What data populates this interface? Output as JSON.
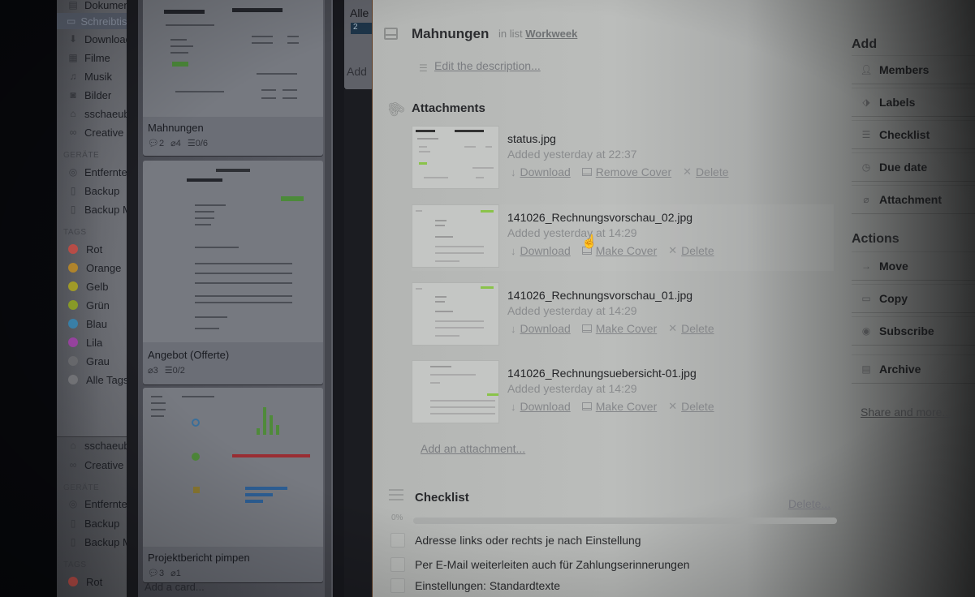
{
  "finder": {
    "favorites": [
      {
        "label": "Dokumente",
        "icon": "document-icon"
      },
      {
        "label": "Schreibtisch",
        "icon": "desktop-icon",
        "selected": true
      },
      {
        "label": "Downloads",
        "icon": "download-icon"
      },
      {
        "label": "Filme",
        "icon": "film-icon"
      },
      {
        "label": "Musik",
        "icon": "music-icon"
      },
      {
        "label": "Bilder",
        "icon": "camera-icon"
      },
      {
        "label": "sschaeub",
        "icon": "home-icon"
      },
      {
        "label": "Creative",
        "icon": "creative-cloud-icon"
      }
    ],
    "devices_header": "GERÄTE",
    "devices": [
      {
        "label": "Entfernte",
        "icon": "disc-icon"
      },
      {
        "label": "Backup",
        "icon": "drive-icon"
      },
      {
        "label": "Backup M",
        "icon": "drive-icon"
      }
    ],
    "tags_header": "TAGS",
    "tags": [
      {
        "label": "Rot",
        "color": "#c0504a"
      },
      {
        "label": "Orange",
        "color": "#b88a2e"
      },
      {
        "label": "Gelb",
        "color": "#a8a22a"
      },
      {
        "label": "Grün",
        "color": "#8fa22a"
      },
      {
        "label": "Blau",
        "color": "#3c86b0"
      },
      {
        "label": "Lila",
        "color": "#a046a8"
      },
      {
        "label": "Grau",
        "color": "#7e7f82"
      },
      {
        "label": "Alle Tags",
        "color": "#8a8b8e"
      }
    ],
    "lower": {
      "favorites": [
        {
          "label": "sschaeub",
          "icon": "home-icon"
        },
        {
          "label": "Creative",
          "icon": "creative-cloud-icon"
        }
      ],
      "devices_header": "GERÄTE",
      "devices": [
        {
          "label": "Entfernte",
          "icon": "disc-icon"
        },
        {
          "label": "Backup",
          "icon": "drive-icon"
        },
        {
          "label": "Backup M",
          "icon": "drive-icon"
        }
      ],
      "tags_header": "TAGS",
      "tags": [
        {
          "label": "Rot",
          "color": "#c0504a"
        }
      ]
    }
  },
  "board": {
    "cards": [
      {
        "title": "Mahnungen",
        "comments": "2",
        "attachments": "4",
        "checklist": "0/6"
      },
      {
        "title": "Angebot (Offerte)",
        "attachments": "3",
        "checklist": "0/2"
      },
      {
        "title": "Projektbericht pimpen",
        "comments": "3",
        "attachments": "1"
      }
    ],
    "add_card": "Add a card...",
    "next_list": {
      "title": "Alle",
      "badge": "2",
      "add": "Add"
    }
  },
  "card_detail": {
    "title": "Mahnungen",
    "in_list_prefix": "in list",
    "list_name": "Workweek",
    "edit_description": "Edit the description...",
    "attachments_title": "Attachments",
    "attachments": [
      {
        "name": "status.jpg",
        "added": "Added yesterday at 22:37",
        "download": "Download",
        "cover": "Remove Cover",
        "delete": "Delete"
      },
      {
        "name": "141026_Rechnungsvorschau_02.jpg",
        "added": "Added yesterday at 14:29",
        "download": "Download",
        "cover": "Make Cover",
        "delete": "Delete"
      },
      {
        "name": "141026_Rechnungsvorschau_01.jpg",
        "added": "Added yesterday at 14:29",
        "download": "Download",
        "cover": "Make Cover",
        "delete": "Delete"
      },
      {
        "name": "141026_Rechnungsuebersicht-01.jpg",
        "added": "Added yesterday at 14:29",
        "download": "Download",
        "cover": "Make Cover",
        "delete": "Delete"
      }
    ],
    "add_attachment": "Add an attachment...",
    "checklist": {
      "title": "Checklist",
      "delete": "Delete...",
      "progress_label": "0%",
      "progress": 0,
      "items": [
        {
          "text": "Adresse links oder rechts je nach Einstellung",
          "checked": false
        },
        {
          "text": "Per E-Mail weiterleiten auch für Zahlungserinnerungen",
          "checked": false
        },
        {
          "text": "Einstellungen: Standardtexte",
          "checked": false
        }
      ]
    }
  },
  "sidebar": {
    "add_header": "Add",
    "add_items": [
      {
        "label": "Members",
        "icon": "person-icon"
      },
      {
        "label": "Labels",
        "icon": "tag-icon"
      },
      {
        "label": "Checklist",
        "icon": "checklist-icon"
      },
      {
        "label": "Due date",
        "icon": "clock-icon"
      },
      {
        "label": "Attachment",
        "icon": "paperclip-icon"
      }
    ],
    "actions_header": "Actions",
    "action_items": [
      {
        "label": "Move",
        "icon": "arrow-right-icon"
      },
      {
        "label": "Copy",
        "icon": "card-icon"
      },
      {
        "label": "Subscribe",
        "icon": "eye-icon"
      },
      {
        "label": "Archive",
        "icon": "archive-icon"
      }
    ],
    "share": "Share and more..."
  }
}
